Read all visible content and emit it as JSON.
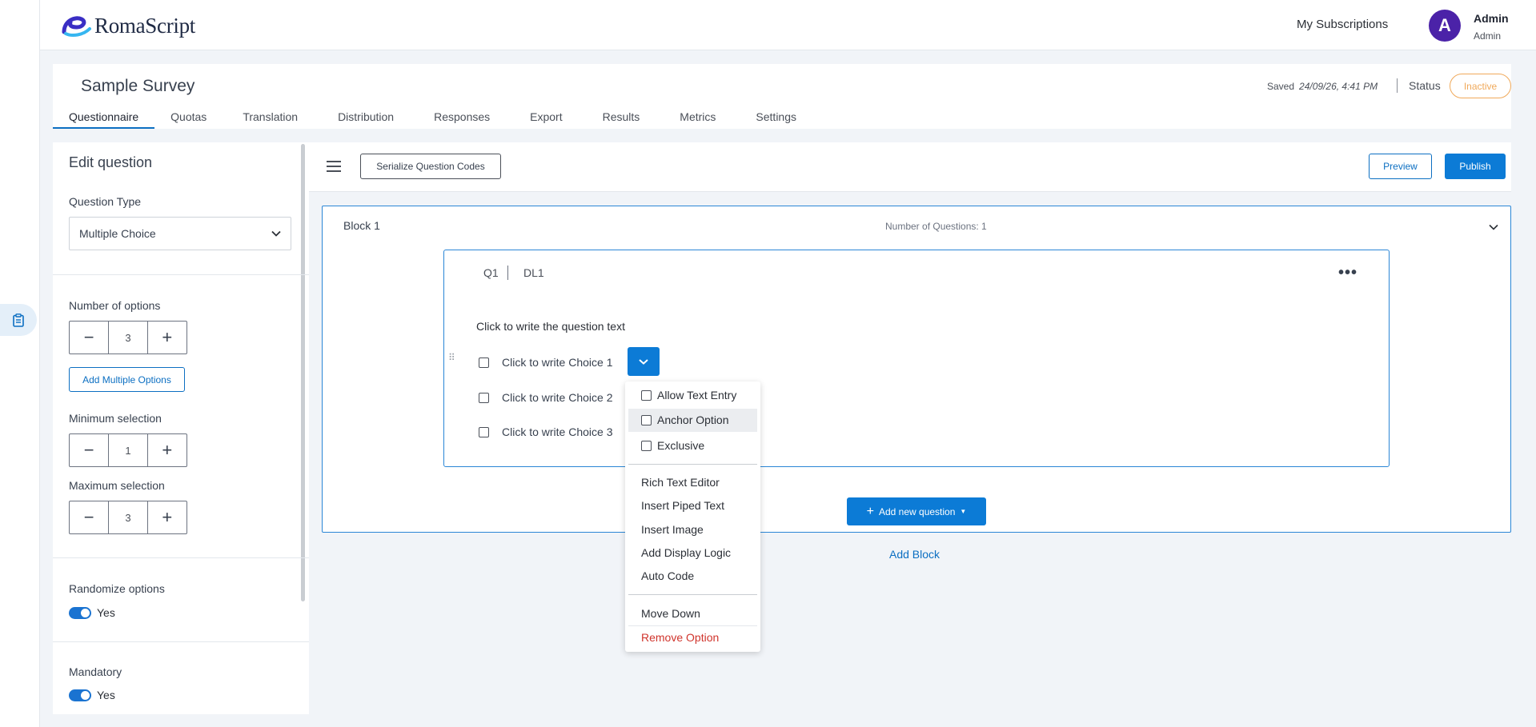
{
  "app": {
    "logo_text": "RomaScript"
  },
  "header": {
    "subscriptions": "My Subscriptions",
    "avatar_letter": "A",
    "user_name": "Admin",
    "user_role": "Admin"
  },
  "survey": {
    "title": "Sample Survey",
    "saved_label": "Saved",
    "saved_time": "24/09/26, 4:41 PM",
    "status_label": "Status",
    "status_value": "Inactive",
    "tabs": [
      "Questionnaire",
      "Quotas",
      "Translation",
      "Distribution",
      "Responses",
      "Export",
      "Results",
      "Metrics",
      "Settings"
    ],
    "active_tab": "Questionnaire"
  },
  "edit_panel": {
    "title": "Edit question",
    "question_type_label": "Question Type",
    "question_type_value": "Multiple Choice",
    "num_options_label": "Number of options",
    "num_options_value": "3",
    "add_multiple_label": "Add Multiple Options",
    "min_selection_label": "Minimum selection",
    "min_selection_value": "1",
    "max_selection_label": "Maximum selection",
    "max_selection_value": "3",
    "randomize_label": "Randomize options",
    "randomize_value": "Yes",
    "mandatory_label": "Mandatory",
    "mandatory_value": "Yes"
  },
  "toolbar": {
    "serialize_label": "Serialize Question Codes",
    "preview_label": "Preview",
    "publish_label": "Publish"
  },
  "block": {
    "title": "Block 1",
    "count_label": "Number of Questions: 1",
    "question": {
      "code": "Q1",
      "data_label": "DL1",
      "text": "Click to write the question text",
      "choices": [
        "Click to write Choice 1",
        "Click to write Choice 2",
        "Click to write Choice 3"
      ]
    },
    "add_question_label": "Add new question"
  },
  "option_menu": {
    "checkbox_items": [
      "Allow Text Entry",
      "Anchor Option",
      "Exclusive"
    ],
    "action_items": [
      "Rich Text Editor",
      "Insert Piped Text",
      "Insert Image",
      "Add Display Logic",
      "Auto Code"
    ],
    "move_down": "Move Down",
    "remove": "Remove Option"
  },
  "add_block_label": "Add Block",
  "colors": {
    "accent": "#0c7bd6",
    "avatar": "#4b22a8",
    "inactive": "#f0a95a",
    "danger": "#d0342c"
  }
}
